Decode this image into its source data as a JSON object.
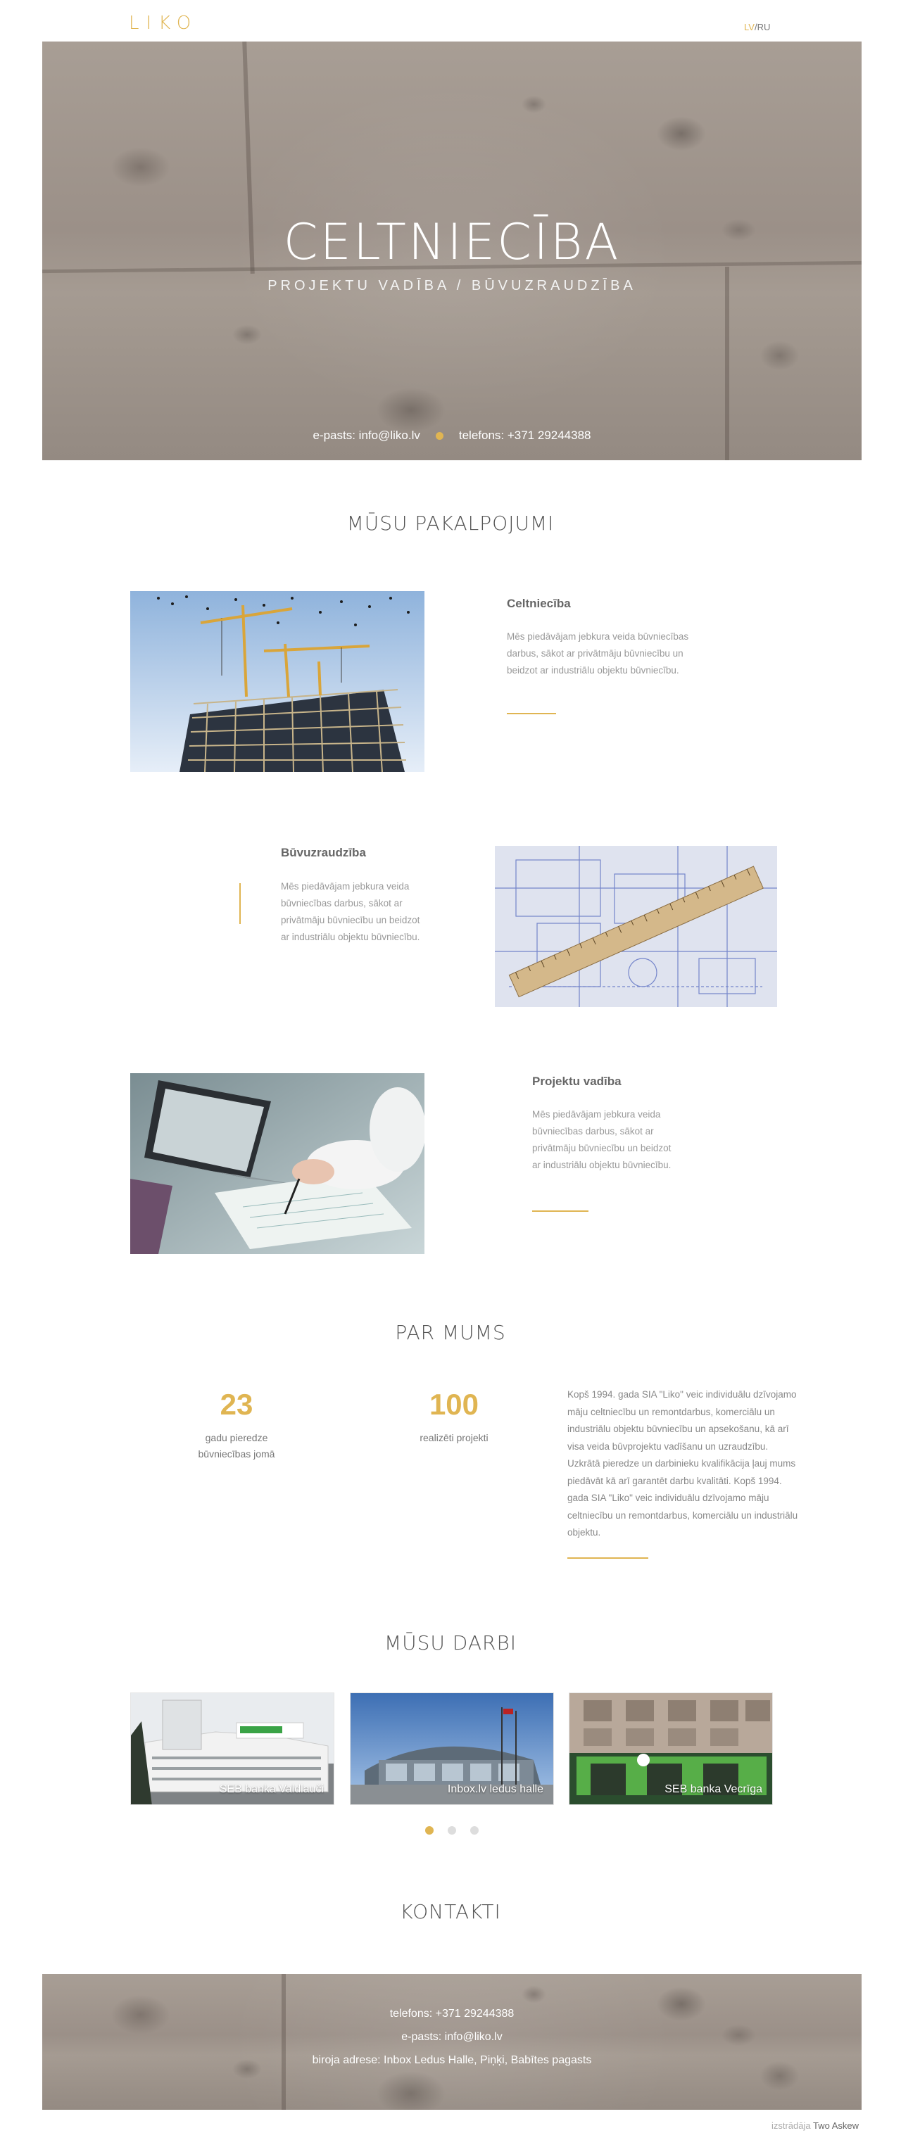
{
  "header": {
    "logo": "LIKO",
    "lang_active": "LV",
    "lang_sep": "/",
    "lang_other": "RU"
  },
  "hero": {
    "title": "CELTNIECĪBA",
    "subtitle": "PROJEKTU VADĪBA / BŪVUZRAUDZĪBA",
    "email": "e-pasts: info@liko.lv",
    "phone": "telefons: +371 29244388"
  },
  "services": {
    "heading": "MŪSU PAKALPOJUMI",
    "items": [
      {
        "title": "Celtniecība",
        "text": "Mēs piedāvājam jebkura veida būvniecības darbus, sākot ar privātmāju būvniecību un beidzot ar industriālu objektu būvniecību."
      },
      {
        "title": "Būvuzraudzība",
        "text": "Mēs piedāvājam jebkura veida būvniecības darbus, sākot ar privātmāju būvniecību un beidzot ar industriālu objektu būvniecību."
      },
      {
        "title": "Projektu vadība",
        "text": "Mēs piedāvājam jebkura veida būvniecības darbus, sākot ar privātmāju būvniecību un beidzot ar industriālu objektu būvniecību."
      }
    ]
  },
  "about": {
    "heading": "PAR MUMS",
    "stat1_num": "23",
    "stat1_label_1": "gadu pieredze",
    "stat1_label_2": "būvniecības jomā",
    "stat2_num": "100",
    "stat2_label": "realizēti projekti",
    "text": "Kopš 1994. gada SIA \"Liko\" veic individuālu dzīvojamo māju celtniecību un remontdarbus, komerciālu un industriālu objektu būvniecību un apsekošanu, kā arī visa veida būvprojektu vadīšanu un uzraudzību. Uzkrātā pieredze un darbinieku kvalifikācija ļauj mums piedāvāt kā arī garantēt darbu kvalitāti. Kopš 1994. gada SIA \"Liko\" veic individuālu dzīvojamo māju celtniecību un remontdarbus, komerciālu un industriālu objektu."
  },
  "works": {
    "heading": "MŪSU DARBI",
    "items": [
      {
        "caption": "SEB banka Valdlauči"
      },
      {
        "caption": "Inbox.lv ledus halle"
      },
      {
        "caption": "SEB banka Vecrīga"
      }
    ],
    "active_slide": 1,
    "slide_count": 3
  },
  "contacts": {
    "heading": "KONTAKTI",
    "phone": "telefons: +371 29244388",
    "email": "e-pasts: info@liko.lv",
    "address": "biroja adrese: Inbox Ledus Halle, Piņķi, Babītes pagasts"
  },
  "footer": {
    "credit_prefix": "izstrādāja",
    "credit_name": "Two Askew"
  },
  "colors": {
    "accent": "#e0b552",
    "text": "#555555",
    "muted": "#999999"
  }
}
